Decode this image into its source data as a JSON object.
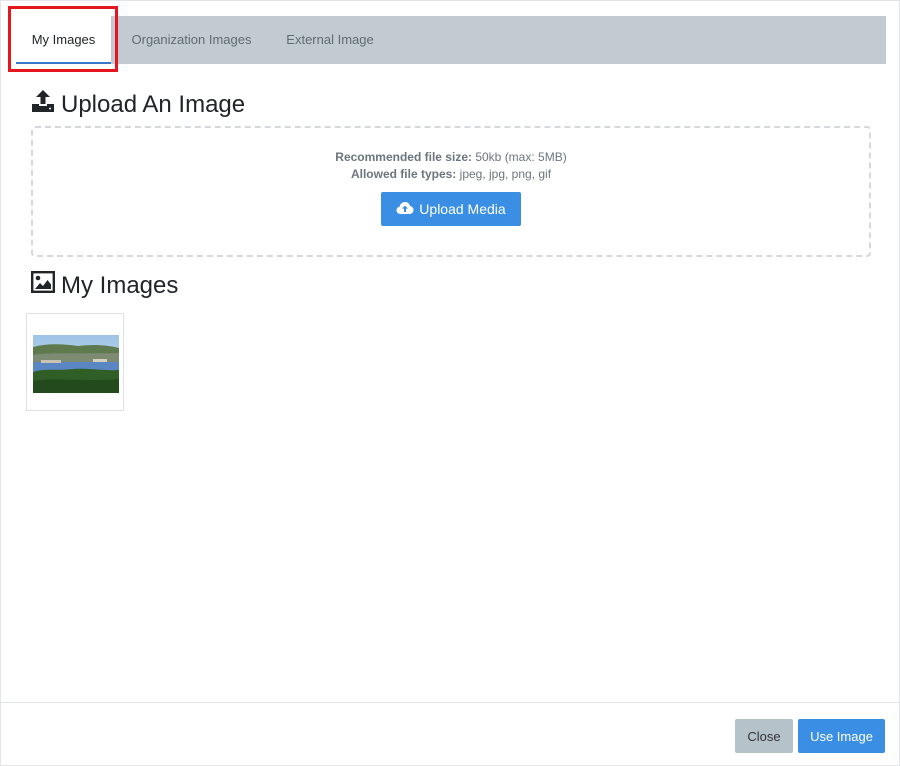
{
  "tabs": [
    {
      "label": "My Images"
    },
    {
      "label": "Organization Images"
    },
    {
      "label": "External Image"
    }
  ],
  "upload": {
    "title": "Upload An Image",
    "recommended_label": "Recommended file size:",
    "recommended_value": " 50kb (max: 5MB)",
    "allowed_label": "Allowed file types:",
    "allowed_value": " jpeg, jpg, png, gif",
    "button_label": "Upload Media"
  },
  "gallery": {
    "title": "My Images"
  },
  "footer": {
    "close_label": "Close",
    "use_label": "Use Image"
  },
  "colors": {
    "accent": "#3a8fe4",
    "tabbar": "#c2cbd1",
    "highlight": "#e5161e"
  }
}
